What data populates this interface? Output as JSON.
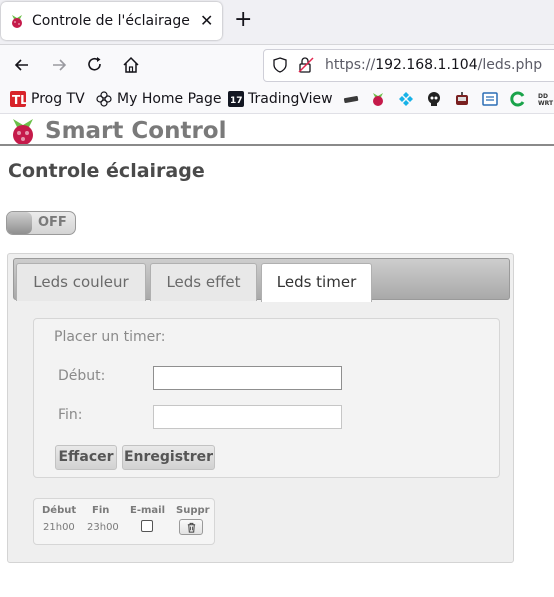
{
  "browser": {
    "tab_title": "Controle de l'éclairage",
    "close_glyph": "✕",
    "newtab_glyph": "+",
    "url_prefix": "https://",
    "url_host": "192.168.1.104",
    "url_path": "/leds.php",
    "bookmarks": [
      {
        "label": "Prog TV",
        "icon": "prog-tv-icon"
      },
      {
        "label": "My Home Page",
        "icon": "flower-icon"
      },
      {
        "label": "TradingView",
        "icon": "tradingview-icon"
      }
    ],
    "extra_bookmark_icons": [
      "keyboard-icon",
      "raspberry-icon",
      "kodi-icon",
      "skull-icon",
      "robot-icon",
      "window-icon",
      "green-swirl-icon",
      "dd-wrt-icon"
    ]
  },
  "site": {
    "brand": "Smart Control",
    "page_title": "Controle éclairage",
    "toggle_label": "OFF",
    "tabs": [
      "Leds couleur",
      "Leds effet",
      "Leds timer"
    ],
    "active_tab": "Leds timer",
    "timer": {
      "heading": "Placer un timer:",
      "start_label": "Début:",
      "end_label": "Fin:",
      "start_value": "",
      "end_value": "",
      "clear_button": "Effacer",
      "save_button": "Enregistrer"
    },
    "list": {
      "headers": [
        "Début",
        "Fin",
        "E-mail",
        "Suppr"
      ],
      "rows": [
        {
          "start": "21h00",
          "end": "23h00",
          "email": false
        }
      ]
    }
  },
  "colors": {
    "raspberry_red": "#c51a4a",
    "leaf_green": "#6cc04a",
    "brand_gray": "#7a7a7a"
  }
}
